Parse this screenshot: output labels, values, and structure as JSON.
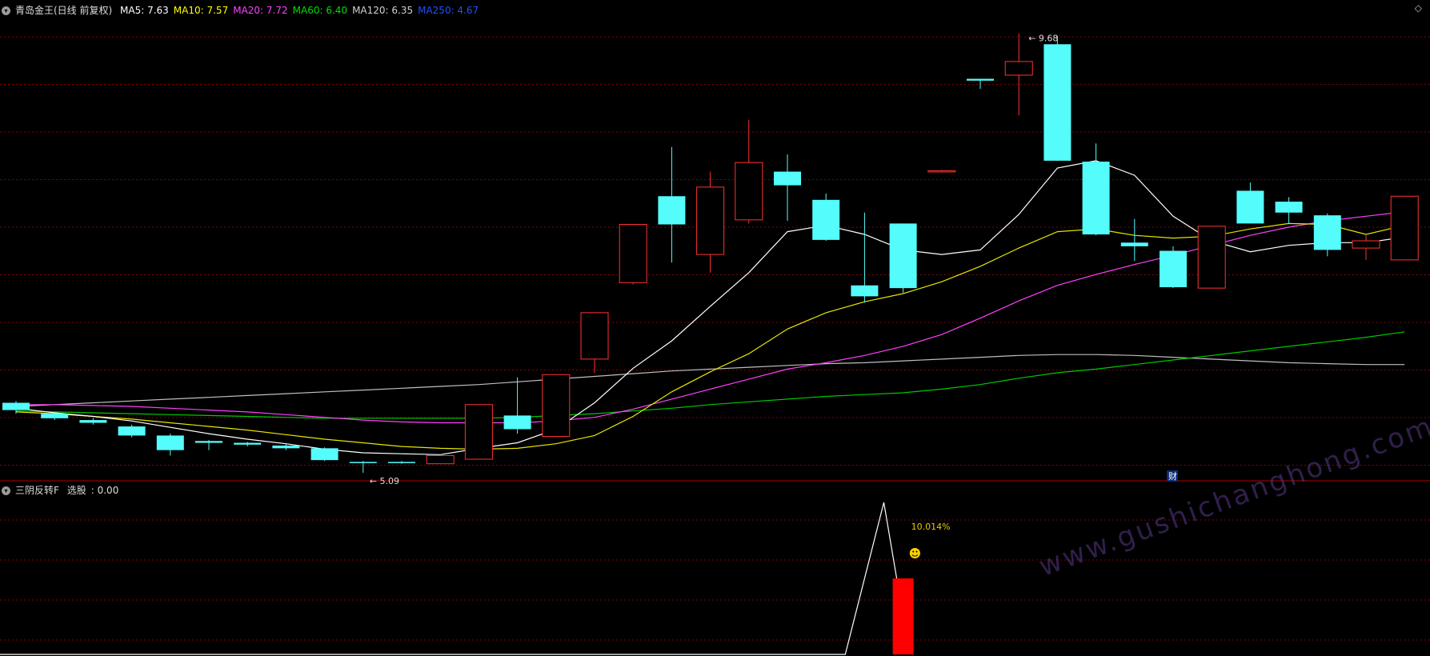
{
  "header": {
    "title": "青岛金王(日线 前复权)",
    "ma": [
      {
        "label": "MA5",
        "value": "7.63",
        "color": "#ffffff"
      },
      {
        "label": "MA10",
        "value": "7.57",
        "color": "#ffff00"
      },
      {
        "label": "MA20",
        "value": "7.72",
        "color": "#ff40ff"
      },
      {
        "label": "MA60",
        "value": "6.40",
        "color": "#00e000"
      },
      {
        "label": "MA120",
        "value": "6.35",
        "color": "#d0d0d0"
      },
      {
        "label": "MA250",
        "value": "4.67",
        "color": "#2050ff"
      }
    ]
  },
  "subchart": {
    "title": "三阴反转F",
    "field_label": "选股",
    "field_value": "0.00",
    "pct_label": "10.014%",
    "smiley": "☻"
  },
  "annotations": {
    "high_label": "9.68",
    "low_label": "5.09",
    "fin_marker": "财"
  },
  "watermark": "www.gushichanghong.com",
  "colors": {
    "up": "#ff3232",
    "down": "#54fcfc",
    "grid": "#8b0000",
    "bg": "#000000"
  },
  "chart_data": {
    "type": "candlestick",
    "price_range": [
      5.0,
      9.8
    ],
    "candles": [
      {
        "o": 5.62,
        "c": 5.54,
        "h": 5.64,
        "l": 5.5
      },
      {
        "o": 5.5,
        "c": 5.45,
        "h": 5.52,
        "l": 5.43
      },
      {
        "o": 5.43,
        "c": 5.4,
        "h": 5.45,
        "l": 5.38
      },
      {
        "o": 5.36,
        "c": 5.26,
        "h": 5.38,
        "l": 5.24
      },
      {
        "o": 5.26,
        "c": 5.1,
        "h": 5.28,
        "l": 5.04
      },
      {
        "o": 5.2,
        "c": 5.18,
        "h": 5.21,
        "l": 5.1
      },
      {
        "o": 5.18,
        "c": 5.16,
        "h": 5.19,
        "l": 5.14
      },
      {
        "o": 5.15,
        "c": 5.12,
        "h": 5.17,
        "l": 5.1
      },
      {
        "o": 5.12,
        "c": 4.99,
        "h": 5.13,
        "l": 4.98
      },
      {
        "o": 4.97,
        "c": 4.96,
        "h": 4.98,
        "l": 4.85
      },
      {
        "o": 4.97,
        "c": 4.96,
        "h": 4.98,
        "l": 4.95
      },
      {
        "o": 4.95,
        "c": 5.04,
        "h": 5.05,
        "l": 4.95
      },
      {
        "o": 5.0,
        "c": 5.6,
        "h": 5.6,
        "l": 5.0
      },
      {
        "o": 5.48,
        "c": 5.33,
        "h": 5.9,
        "l": 5.28
      },
      {
        "o": 5.25,
        "c": 5.93,
        "h": 5.93,
        "l": 5.25
      },
      {
        "o": 6.1,
        "c": 6.61,
        "h": 6.61,
        "l": 5.95
      },
      {
        "o": 6.94,
        "c": 7.58,
        "h": 7.58,
        "l": 6.92
      },
      {
        "o": 7.89,
        "c": 7.58,
        "h": 8.43,
        "l": 7.16
      },
      {
        "o": 7.25,
        "c": 7.99,
        "h": 8.16,
        "l": 7.05
      },
      {
        "o": 7.63,
        "c": 8.26,
        "h": 8.73,
        "l": 7.59
      },
      {
        "o": 8.16,
        "c": 8.01,
        "h": 8.35,
        "l": 7.62
      },
      {
        "o": 7.85,
        "c": 7.41,
        "h": 7.92,
        "l": 7.4
      },
      {
        "o": 6.91,
        "c": 6.79,
        "h": 7.71,
        "l": 6.72
      },
      {
        "o": 7.59,
        "c": 6.88,
        "h": 7.59,
        "l": 6.83
      },
      {
        "o": 8.17,
        "c": 8.17,
        "h": 8.18,
        "l": 8.15
      },
      {
        "o": 9.18,
        "c": 9.16,
        "h": 9.18,
        "l": 9.07
      },
      {
        "o": 9.22,
        "c": 9.37,
        "h": 9.68,
        "l": 8.78
      },
      {
        "o": 9.56,
        "c": 8.28,
        "h": 9.65,
        "l": 8.28
      },
      {
        "o": 8.27,
        "c": 7.47,
        "h": 8.47,
        "l": 7.46
      },
      {
        "o": 7.38,
        "c": 7.34,
        "h": 7.64,
        "l": 7.18
      },
      {
        "o": 7.29,
        "c": 6.89,
        "h": 7.34,
        "l": 6.88
      },
      {
        "o": 6.88,
        "c": 7.56,
        "h": 7.56,
        "l": 6.88
      },
      {
        "o": 7.95,
        "c": 7.59,
        "h": 8.04,
        "l": 7.59
      },
      {
        "o": 7.83,
        "c": 7.71,
        "h": 7.88,
        "l": 7.59
      },
      {
        "o": 7.68,
        "c": 7.3,
        "h": 7.7,
        "l": 7.23
      },
      {
        "o": 7.32,
        "c": 7.4,
        "h": 7.47,
        "l": 7.19
      },
      {
        "o": 7.19,
        "c": 7.89,
        "h": 7.89,
        "l": 7.19
      }
    ],
    "ma5": [
      5.56,
      5.51,
      5.47,
      5.42,
      5.35,
      5.28,
      5.22,
      5.17,
      5.11,
      5.07,
      5.06,
      5.05,
      5.12,
      5.18,
      5.33,
      5.62,
      6.0,
      6.3,
      6.68,
      7.05,
      7.5,
      7.57,
      7.47,
      7.3,
      7.25,
      7.3,
      7.69,
      8.2,
      8.28,
      8.12,
      7.67,
      7.4,
      7.28,
      7.35,
      7.38,
      7.38,
      7.44
    ],
    "ma10": [
      5.52,
      5.5,
      5.47,
      5.44,
      5.4,
      5.36,
      5.32,
      5.27,
      5.22,
      5.18,
      5.14,
      5.12,
      5.11,
      5.12,
      5.17,
      5.26,
      5.47,
      5.74,
      5.96,
      6.16,
      6.43,
      6.61,
      6.73,
      6.82,
      6.95,
      7.12,
      7.32,
      7.5,
      7.53,
      7.46,
      7.43,
      7.45,
      7.53,
      7.59,
      7.58,
      7.47,
      7.57
    ],
    "ma20": [
      5.6,
      5.6,
      5.59,
      5.58,
      5.56,
      5.54,
      5.52,
      5.49,
      5.46,
      5.43,
      5.41,
      5.4,
      5.4,
      5.4,
      5.42,
      5.46,
      5.55,
      5.66,
      5.77,
      5.88,
      5.99,
      6.06,
      6.14,
      6.24,
      6.37,
      6.55,
      6.74,
      6.91,
      7.03,
      7.14,
      7.24,
      7.35,
      7.46,
      7.55,
      7.62,
      7.67,
      7.72
    ],
    "ma60": [
      5.53,
      5.52,
      5.51,
      5.5,
      5.49,
      5.48,
      5.47,
      5.46,
      5.45,
      5.45,
      5.45,
      5.45,
      5.45,
      5.46,
      5.48,
      5.5,
      5.53,
      5.56,
      5.6,
      5.63,
      5.66,
      5.69,
      5.71,
      5.73,
      5.77,
      5.82,
      5.89,
      5.95,
      5.99,
      6.04,
      6.09,
      6.14,
      6.19,
      6.24,
      6.29,
      6.34,
      6.4
    ],
    "ma120": [
      5.58,
      5.6,
      5.62,
      5.64,
      5.66,
      5.68,
      5.7,
      5.72,
      5.74,
      5.76,
      5.78,
      5.8,
      5.82,
      5.85,
      5.88,
      5.91,
      5.94,
      5.97,
      5.99,
      6.01,
      6.03,
      6.05,
      6.06,
      6.08,
      6.1,
      6.12,
      6.14,
      6.15,
      6.15,
      6.14,
      6.12,
      6.1,
      6.08,
      6.06,
      6.05,
      6.04,
      6.04
    ],
    "indicator": {
      "range": [
        0,
        1.0
      ],
      "line_x_index": [
        0,
        21.5,
        22.5,
        23.0
      ],
      "line_y": [
        0,
        0,
        1.0,
        0.25
      ],
      "bar_index": 23,
      "bar_value": 0.5
    }
  }
}
